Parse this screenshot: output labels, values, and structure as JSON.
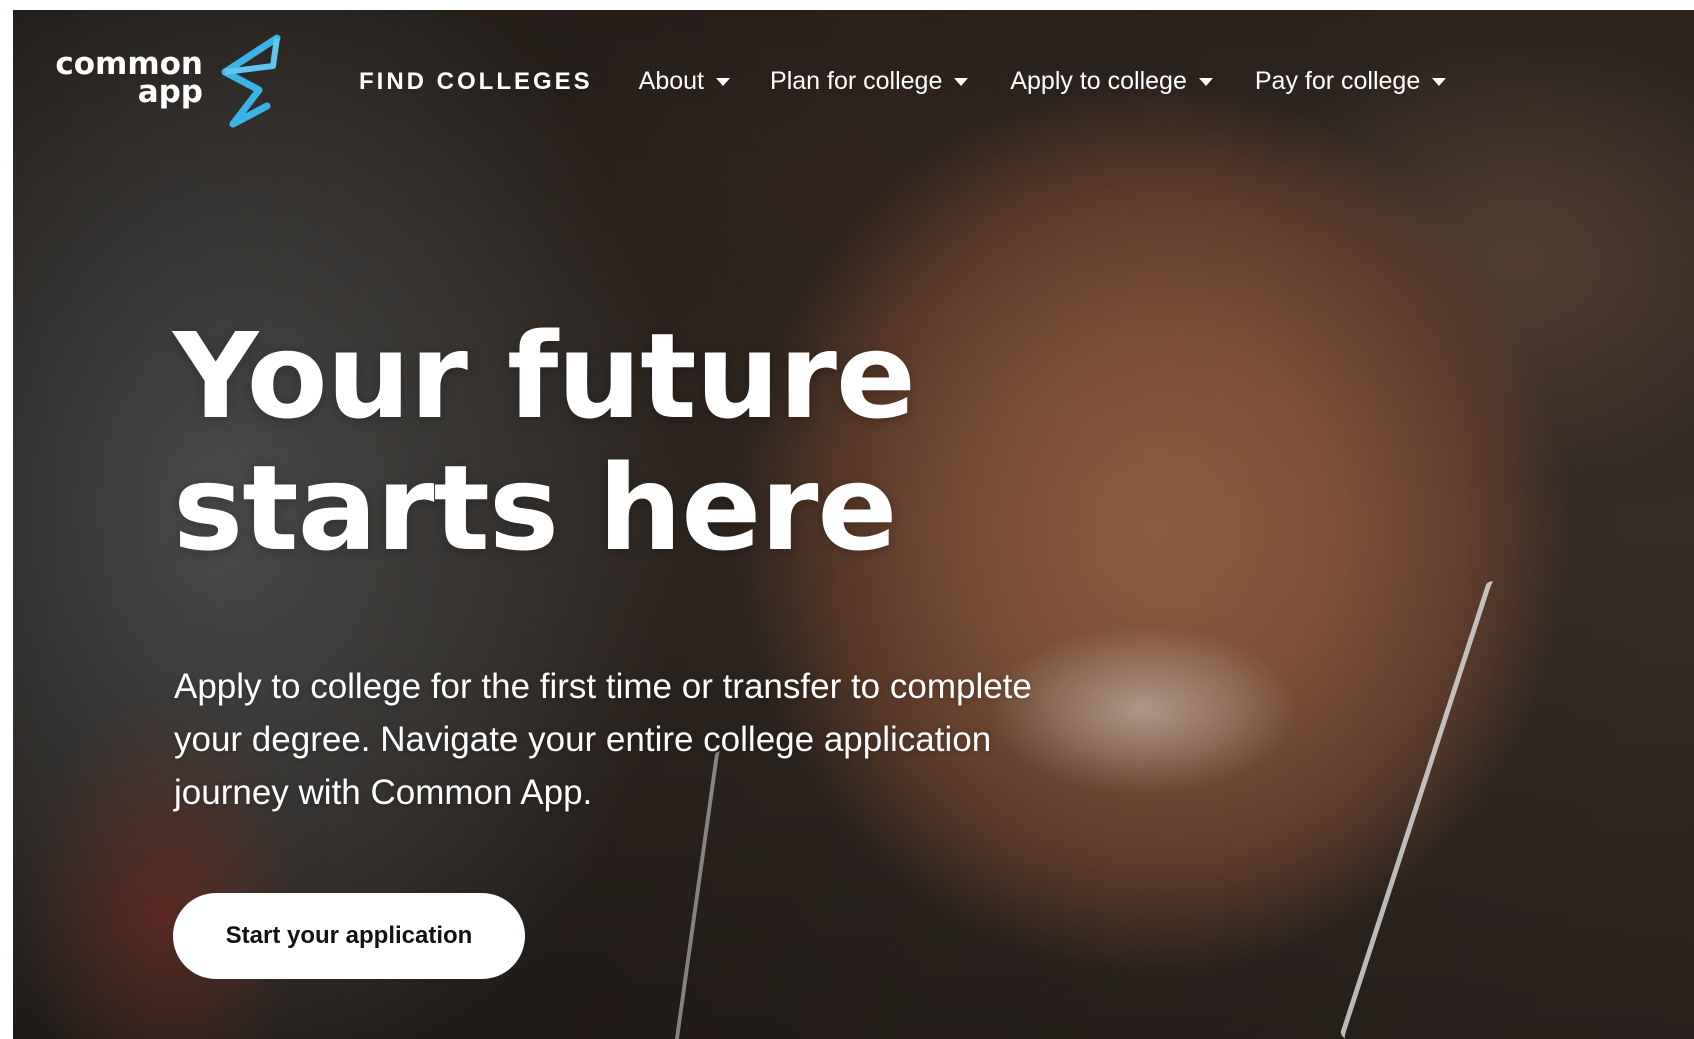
{
  "brand": {
    "logo_line1": "common",
    "logo_line2": "app",
    "accent_color": "#3bb4e5"
  },
  "nav": {
    "find_colleges": "FIND COLLEGES",
    "about": "About",
    "plan": "Plan for college",
    "apply": "Apply to college",
    "pay": "Pay for college"
  },
  "hero": {
    "headline_line1": "Your future",
    "headline_line2": "starts here",
    "subhead": "Apply to college for the first time or transfer to complete your degree. Navigate your entire college application journey with Common App.",
    "cta_label": "Start your application"
  }
}
